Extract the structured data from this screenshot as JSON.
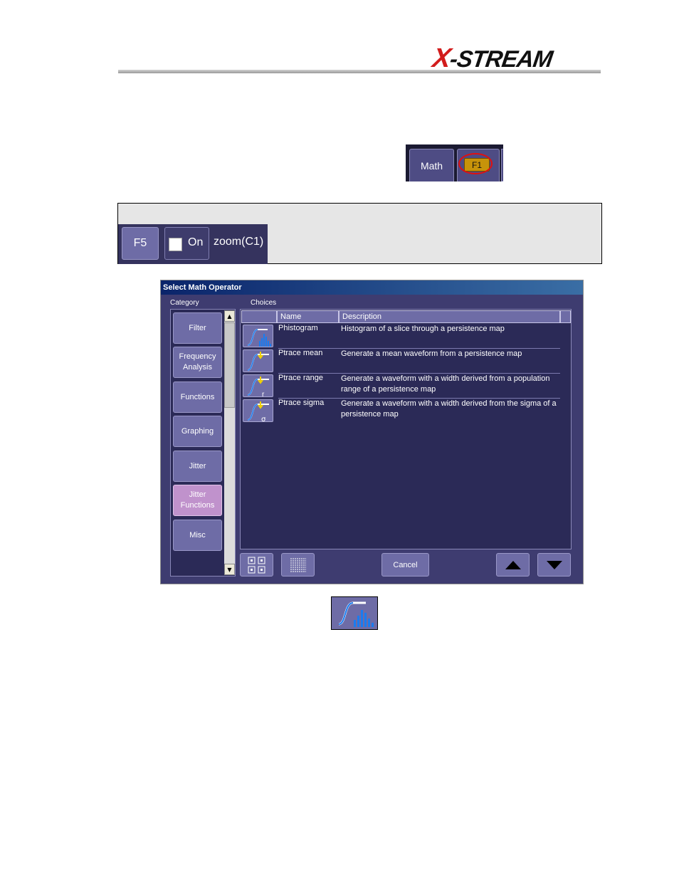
{
  "header": {
    "logo_text": "X-STREAM"
  },
  "tabstrip": {
    "math_label": "Math",
    "f1_label": "F1"
  },
  "trace": {
    "f5_label": "F5",
    "on_label": "On",
    "source_label": "zoom(C1)"
  },
  "dialog": {
    "title": "Select Math Operator",
    "category_label": "Category",
    "choices_label": "Choices",
    "categories": [
      {
        "label": "Filter"
      },
      {
        "label": "Frequency Analysis"
      },
      {
        "label": "Functions"
      },
      {
        "label": "Graphing"
      },
      {
        "label": "Jitter"
      },
      {
        "label": "Jitter Functions"
      },
      {
        "label": "Misc"
      }
    ],
    "active_category": "Jitter Functions",
    "columns": {
      "name": "Name",
      "description": "Description"
    },
    "rows": [
      {
        "name": "Phistogram",
        "description": "Histogram of a slice through a persistence map",
        "icon": "phistogram-icon"
      },
      {
        "name": "Ptrace mean",
        "description": "Generate a mean waveform from a persistence map",
        "icon": "ptrace-mean-icon"
      },
      {
        "name": "Ptrace range",
        "description": "Generate a waveform with a width derived from a population range of a persistence map",
        "icon": "ptrace-range-icon"
      },
      {
        "name": "Ptrace sigma",
        "description": "Generate a waveform with a width derived from the sigma of a persistence map",
        "icon": "ptrace-sigma-icon"
      }
    ],
    "cancel_label": "Cancel"
  },
  "colors": {
    "dialog_bg": "#3e3c70",
    "panel_bg": "#2b2a57",
    "button": "#6e6ca6",
    "active_category": "#c092cc",
    "f1_badge": "#c7930a",
    "highlight_ring": "#e01010",
    "logo_accent": "#d21c1c"
  }
}
